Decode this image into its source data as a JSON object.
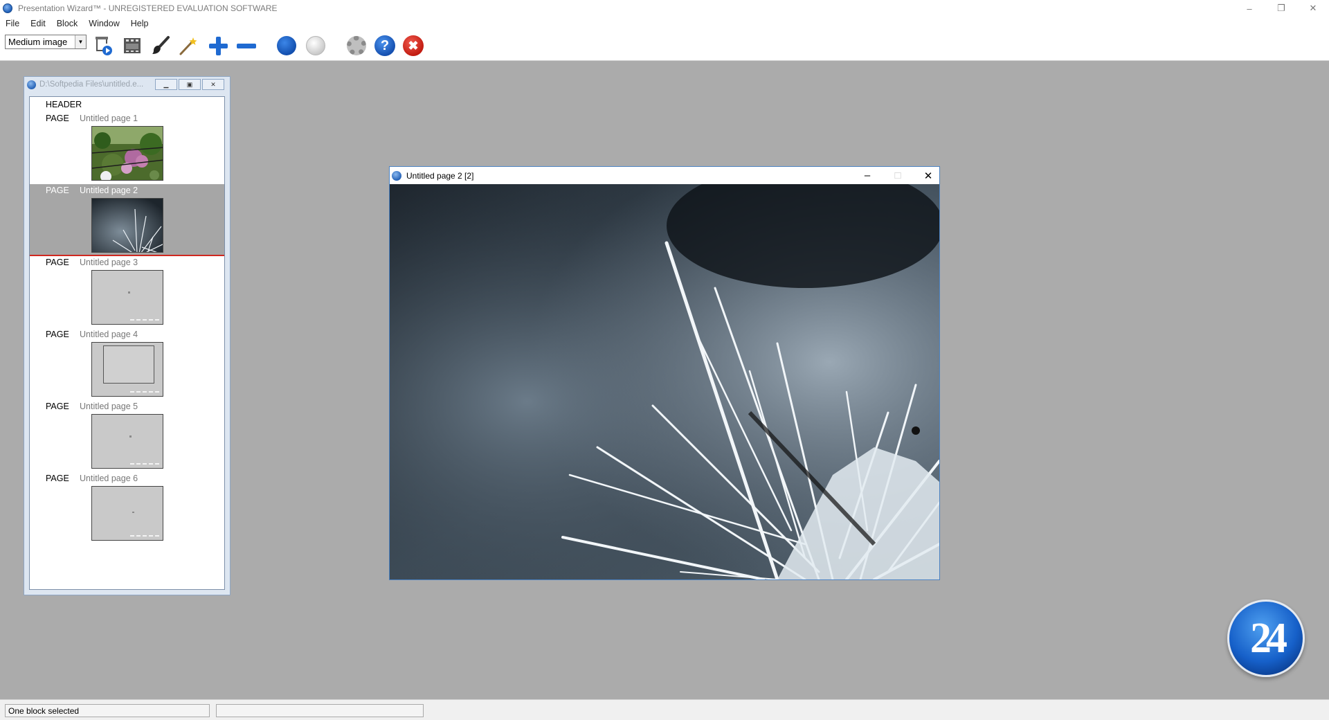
{
  "window": {
    "title": "Presentation Wizard™ - UNREGISTERED EVALUATION SOFTWARE",
    "min": "–",
    "restore": "❐",
    "close": "✕"
  },
  "menu": [
    "File",
    "Edit",
    "Block",
    "Window",
    "Help"
  ],
  "toolbar": {
    "size_select": "Medium image",
    "help_label": "?",
    "close_label": "✖"
  },
  "outline_window": {
    "title": "D:\\Softpedia Files\\untitled.e...",
    "header_label": "HEADER",
    "page_keyword": "PAGE",
    "pages": [
      {
        "name": "Untitled page 1",
        "thumb": "flowers-photo"
      },
      {
        "name": "Untitled page 2",
        "thumb": "frost-photo",
        "selected": true
      },
      {
        "name": "Untitled page 3",
        "thumb": "blank"
      },
      {
        "name": "Untitled page 4",
        "thumb": "frame"
      },
      {
        "name": "Untitled page 5",
        "thumb": "blank"
      },
      {
        "name": "Untitled page 6",
        "thumb": "blank"
      }
    ]
  },
  "page_window": {
    "title": "Untitled page 2   [2]",
    "min": "–",
    "max": "□",
    "close": "✕"
  },
  "logo_text": "24",
  "status": {
    "message": "One block selected",
    "secondary": ""
  },
  "colors": {
    "workspace": "#ababab",
    "selection_row": "#a6a6a6",
    "selection_underline": "#d0281f",
    "accent_blue": "#1f6ad1",
    "close_red": "#c21c11"
  }
}
